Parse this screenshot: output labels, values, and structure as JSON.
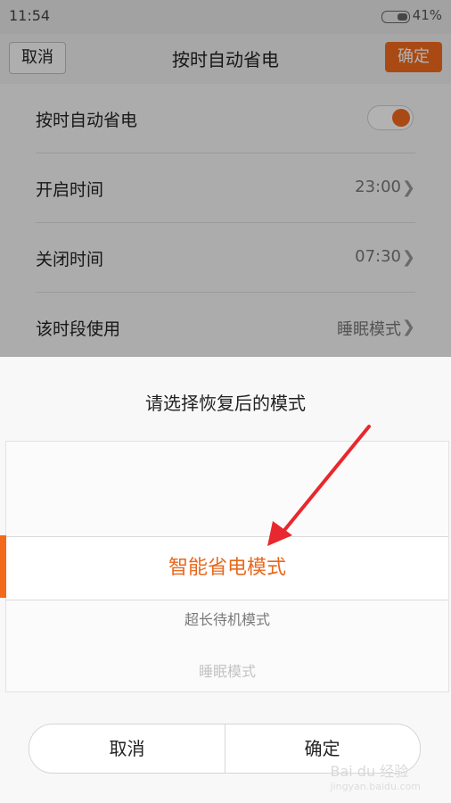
{
  "status_bar": {
    "time": "11:54",
    "battery_pct": "41%",
    "battery_level": 0.41
  },
  "header": {
    "cancel": "取消",
    "title": "按时自动省电",
    "ok": "确定"
  },
  "settings": {
    "auto_save_label": "按时自动省电",
    "auto_save_enabled": true,
    "start_label": "开启时间",
    "start_value": "23:00",
    "end_label": "关闭时间",
    "end_value": "07:30",
    "period_label": "该时段使用",
    "period_value": "睡眠模式"
  },
  "dialog": {
    "prompt": "请选择恢复后的模式",
    "options": [
      "智能省电模式",
      "超长待机模式",
      "睡眠模式"
    ],
    "selected_index": 0,
    "cancel": "取消",
    "ok": "确定"
  },
  "watermark": {
    "text": "Bai du 经验",
    "sub": "jingyan.baidu.com"
  },
  "colors": {
    "accent": "#f26b1d"
  }
}
